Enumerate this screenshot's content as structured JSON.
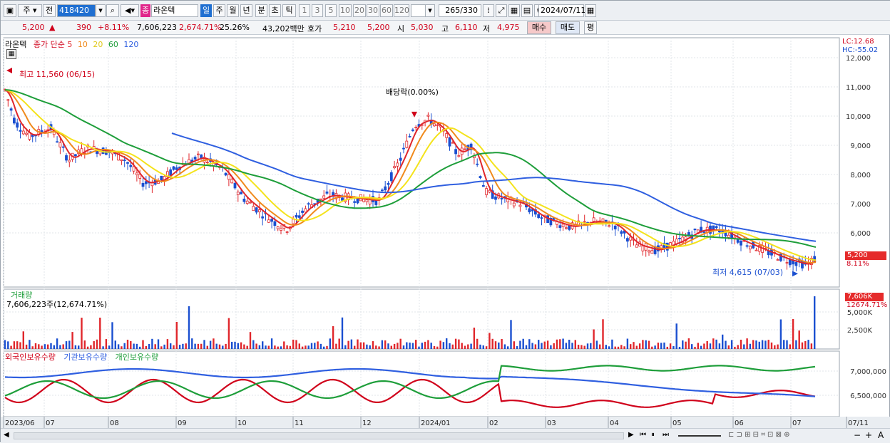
{
  "toolbar": {
    "main_btn": "주",
    "prev_btn": "전",
    "code": "418420",
    "stock_badge": "종",
    "stock_name": "라온텍",
    "periods": [
      "일",
      "주",
      "월",
      "년",
      "분",
      "초",
      "틱"
    ],
    "active_period": "일",
    "intervals": [
      "1",
      "3",
      "5",
      "10",
      "20",
      "30",
      "60",
      "120"
    ],
    "count": "265",
    "total": "/330",
    "date": "2024/07/11"
  },
  "quote": {
    "price": "5,200",
    "change": "390",
    "change_pct": "+8.11%",
    "volume": "7,606,223",
    "volume_ratio": "2,674.71%",
    "turnover": "25.26%",
    "amount": "43,202백만",
    "ask_label": "호가",
    "ask1": "5,210",
    "ask2": "5,200",
    "open_label": "시",
    "open": "5,030",
    "high_label": "고",
    "high": "6,110",
    "low_label": "저",
    "low": "4,975",
    "buy_btn": "매수",
    "sell_btn": "매도",
    "eval_btn": "평"
  },
  "price_pane": {
    "title": "라온텍",
    "indicator": "종가 단순",
    "ma_periods": [
      "5",
      "10",
      "20",
      "60",
      "120"
    ],
    "lc": "LC:12.68",
    "hc": "HC:-55.02",
    "max_label": "최고 11,560 (06/15)",
    "min_label": "최저 4,615 (07/03)",
    "dividend_label": "배당락(0.00%)",
    "last_price": "5,200",
    "last_pct": "8.11%",
    "ticks": [
      "12,000",
      "11,000",
      "10,000",
      "9,000",
      "8,000",
      "7,000",
      "6,000"
    ],
    "colors": {
      "ma5": "#e0262b",
      "ma10": "#f08a1c",
      "ma20": "#f4e31c",
      "ma60": "#1e9e3a",
      "ma120": "#2f5fe0"
    }
  },
  "volume_pane": {
    "title": "거래량",
    "value": "7,606,223주(12,674.71%)",
    "last": "7,606K",
    "last_pct": "12674.71%",
    "ticks": [
      "5,000K",
      "2,500K"
    ]
  },
  "holding_pane": {
    "legend": [
      "외국인보유수량",
      "기관보유수량",
      "개인보유수량"
    ],
    "ticks": [
      "7,000,000",
      "6,500,000"
    ]
  },
  "x_axis": [
    "2023/06",
    "07",
    "08",
    "09",
    "10",
    "11",
    "12",
    "2024/01",
    "02",
    "03",
    "04",
    "05",
    "06",
    "07",
    "07/11"
  ]
}
